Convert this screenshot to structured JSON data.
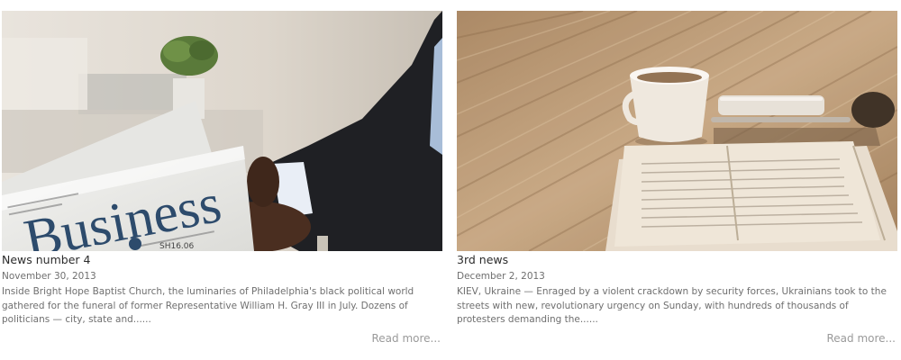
{
  "cards": [
    {
      "title": "News number 4",
      "date": "November 30, 2013",
      "excerpt": "Inside Bright Hope Baptist Church, the luminaries of Philadelphia's black political world gathered for the funeral of former Representative William H. Gray III in July. Dozens of politicians — city, state and......",
      "read_more": "Read more...",
      "image": {
        "headline_text": "Business",
        "price_text": "SH16.06"
      }
    },
    {
      "title": "3rd news",
      "date": "December 2, 2013",
      "excerpt": "KIEV, Ukraine — Enraged by a violent crackdown by security forces, Ukrainians took to the streets with new, revolutionary urgency on Sunday, with hundreds of thousands of protesters demanding the......",
      "read_more": "Read more..."
    }
  ]
}
